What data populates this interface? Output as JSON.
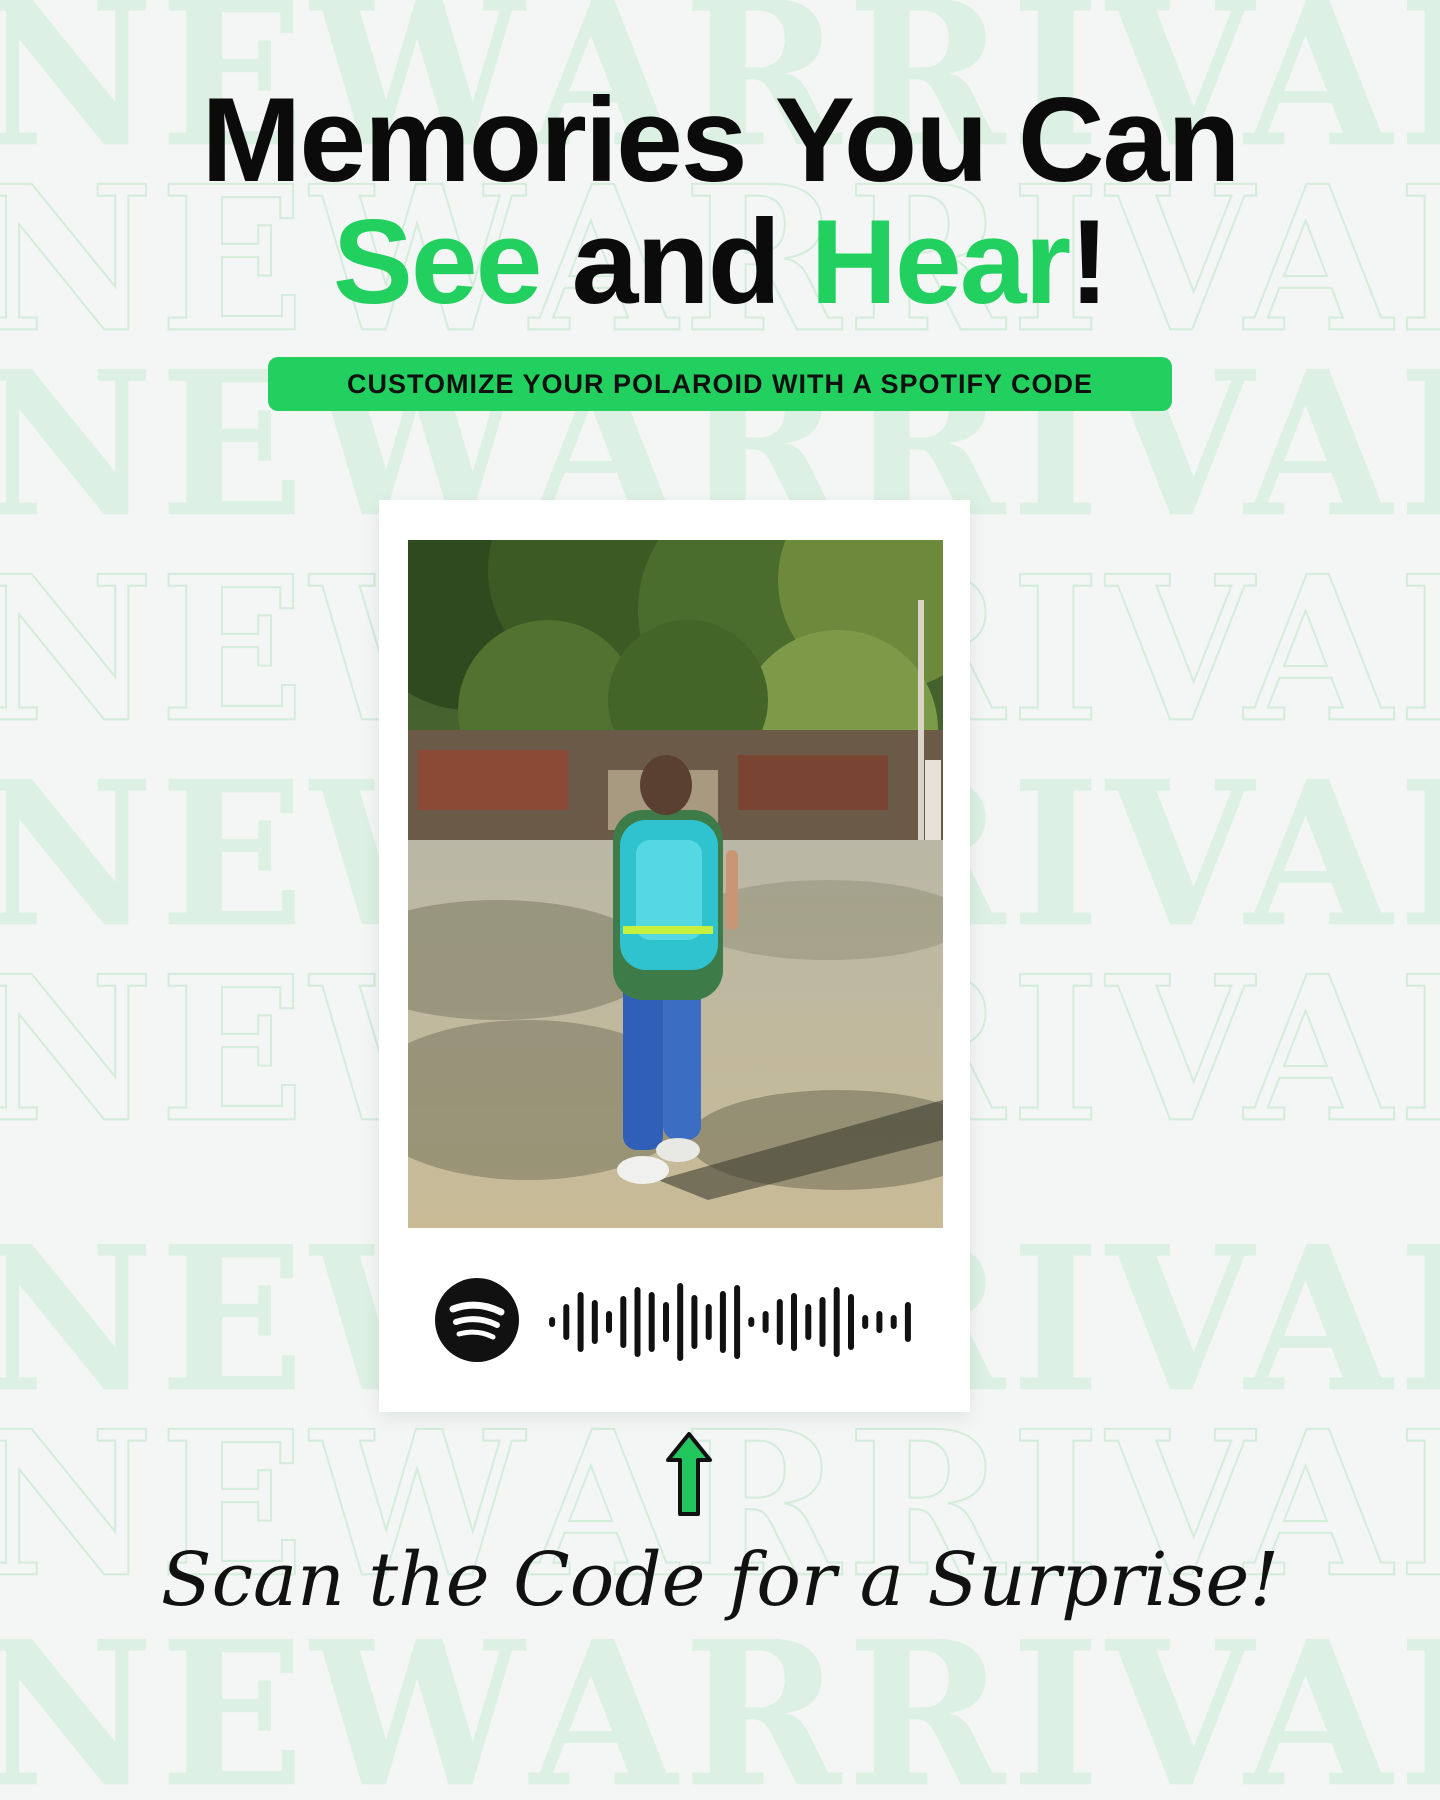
{
  "background": {
    "watermark_left": "NEW",
    "watermark_right": "ARRIVAL",
    "rows": 9
  },
  "headline": {
    "line1": "Memories You Can",
    "line2_part1": "See",
    "line2_part2": " and ",
    "line2_part3": "Hear",
    "line2_part4": "!"
  },
  "tagline": "CUSTOMIZE YOUR POLAROID WITH A SPOTIFY CODE",
  "polaroid": {
    "photo_icon": "person-walking-photo",
    "logo_icon": "spotify-logo-icon",
    "code_icon": "spotify-code-soundwave"
  },
  "arrow_icon": "arrow-up-icon",
  "cta": "Scan the Code for a Surprise!",
  "colors": {
    "accent": "#22d05f",
    "text": "#0b0b0b",
    "background": "#f3f6f4",
    "watermark": "#dcf0e3"
  }
}
